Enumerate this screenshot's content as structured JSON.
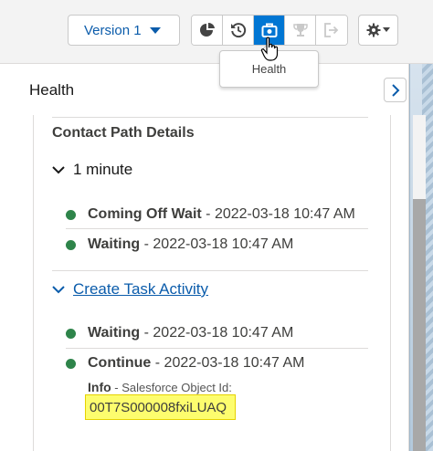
{
  "toolbar": {
    "version_label": "Version 1",
    "buttons": [
      {
        "icon": "pie-chart-icon",
        "active": false
      },
      {
        "icon": "history-icon",
        "active": false
      },
      {
        "icon": "health-icon",
        "active": true
      },
      {
        "icon": "trophy-icon",
        "active": false,
        "disabled": true
      },
      {
        "icon": "exit-icon",
        "active": false,
        "disabled": true
      }
    ],
    "settings_icon": "gear-icon"
  },
  "tooltip": {
    "text": "Health"
  },
  "panel": {
    "title": "Health",
    "section_title": "Contact Path Details",
    "groups": [
      {
        "label": "1 minute",
        "is_link": false,
        "events": [
          {
            "name": "Coming Off Wait",
            "separator": " - ",
            "time": "2022-03-18 10:47 AM"
          },
          {
            "name": "Waiting",
            "separator": " - ",
            "time": "2022-03-18 10:47 AM"
          }
        ]
      },
      {
        "label": "Create Task Activity",
        "is_link": true,
        "events": [
          {
            "name": "Waiting",
            "separator": " - ",
            "time": "2022-03-18 10:47 AM"
          },
          {
            "name": "Continue",
            "separator": " - ",
            "time": "2022-03-18 10:47 AM"
          }
        ]
      }
    ],
    "info": {
      "label": "Info",
      "description": " - Salesforce Object Id:",
      "object_id": "00T7S000008fxiLUAQ"
    }
  },
  "colors": {
    "accent": "#0176d3",
    "link": "#0b5cab",
    "status_dot": "#2e844a",
    "highlight": "#fdfd6e"
  }
}
